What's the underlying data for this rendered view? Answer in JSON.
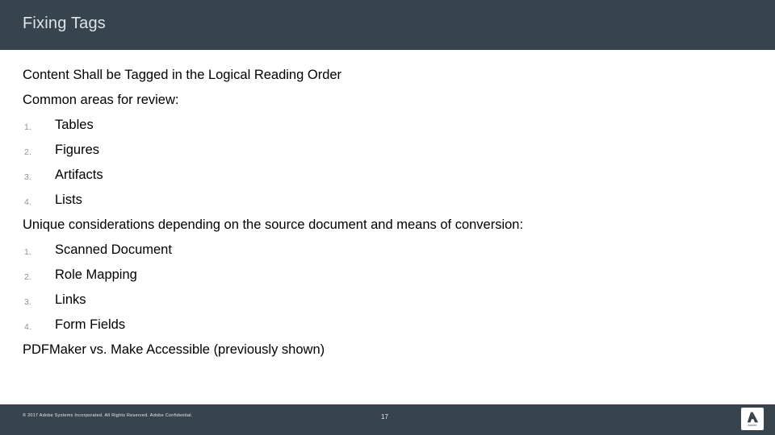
{
  "slide": {
    "title": "Fixing Tags",
    "theme": {
      "bar_background": "#37444e",
      "bar_text": "#dfe3e6",
      "body_background": "#ffffff",
      "body_text": "#000000",
      "list_marker": "#8f8f99"
    }
  },
  "content": {
    "intro_line": "Content Shall be Tagged in the Logical Reading Order",
    "common_areas_heading": "Common areas for review:",
    "common_areas": [
      {
        "marker": "1.",
        "label": "Tables"
      },
      {
        "marker": "2.",
        "label": "Figures"
      },
      {
        "marker": "3.",
        "label": "Artifacts"
      },
      {
        "marker": "4.",
        "label": "Lists"
      }
    ],
    "considerations_heading": "Unique considerations depending on the source document and means of conversion:",
    "considerations": [
      {
        "marker": "1.",
        "label": "Scanned Document"
      },
      {
        "marker": "2.",
        "label": "Role Mapping"
      },
      {
        "marker": "3.",
        "label": "Links"
      },
      {
        "marker": "4.",
        "label": "Form Fields"
      }
    ],
    "closing_line": "PDFMaker vs. Make Accessible (previously shown)"
  },
  "footer": {
    "copyright": "© 2017 Adobe Systems Incorporated.  All Rights Reserved.  Adobe Confidential.",
    "page_number": "17",
    "logo_wordmark": "Adobe"
  }
}
